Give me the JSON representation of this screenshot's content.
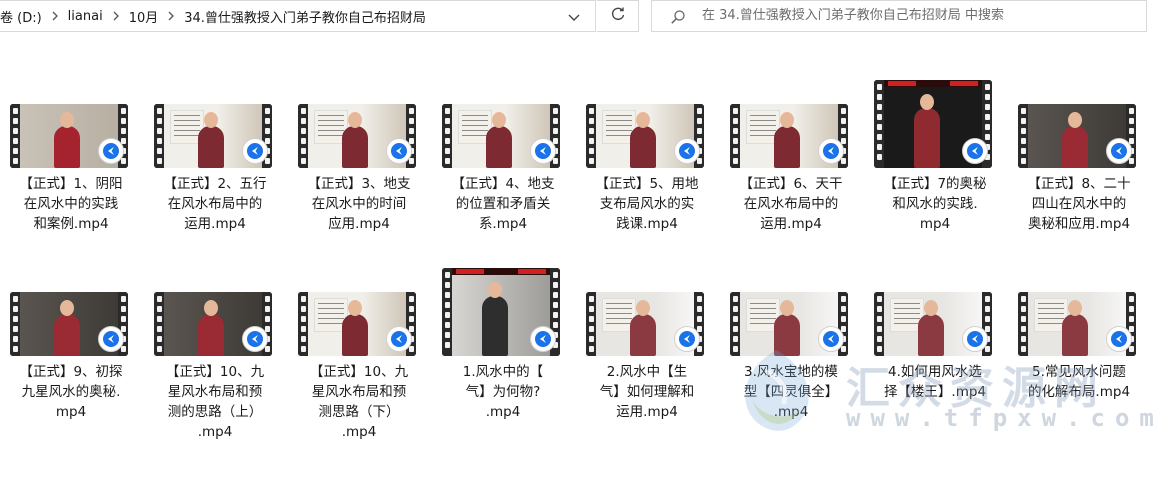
{
  "window": {
    "breadcrumbs": [
      "卷 (D:)",
      "lianai",
      "10月",
      "34.曾仕强教授入门弟子教你自己布招财局"
    ],
    "search_placeholder": "在 34.曾仕强教授入门弟子教你自己布招财局 中搜索"
  },
  "colors": {
    "accent": "#1a73e8",
    "border": "#d9d9d9",
    "text": "#1a1a1a",
    "placeholder": "#6d6d6d"
  },
  "icons": [
    "chevron-right-icon",
    "chevron-down-icon",
    "refresh-icon",
    "search-icon",
    "play-icon",
    "film-strip-icon"
  ],
  "files": [
    {
      "lines": [
        "【正式】1、阴阳",
        "在风水中的实践",
        "和案例.mp4"
      ],
      "thumb": "short",
      "scene": "red-wall"
    },
    {
      "lines": [
        "【正式】2、五行",
        "在风水布局中的",
        "运用.mp4"
      ],
      "thumb": "short",
      "scene": "board"
    },
    {
      "lines": [
        "【正式】3、地支",
        "在风水中的时间",
        "应用.mp4"
      ],
      "thumb": "short",
      "scene": "board"
    },
    {
      "lines": [
        "【正式】4、地支",
        "的位置和矛盾关",
        "系.mp4"
      ],
      "thumb": "short",
      "scene": "board"
    },
    {
      "lines": [
        "【正式】5、用地",
        "支布局风水的实",
        "践课.mp4"
      ],
      "thumb": "short",
      "scene": "board"
    },
    {
      "lines": [
        "【正式】6、天干",
        "在风水布局中的",
        "运用.mp4"
      ],
      "thumb": "short",
      "scene": "board"
    },
    {
      "lines": [
        "【正式】7的奥秘",
        "和风水的实践.",
        "mp4"
      ],
      "thumb": "tall",
      "scene": "red-banner"
    },
    {
      "lines": [
        "【正式】8、二十",
        "四山在风水中的",
        "奥秘和应用.mp4"
      ],
      "thumb": "short",
      "scene": "dark"
    },
    {
      "lines": [
        "【正式】9、初探",
        "九星风水的奥秘.",
        "mp4"
      ],
      "thumb": "short",
      "scene": "dark"
    },
    {
      "lines": [
        "【正式】10、九",
        "星风水布局和预",
        "测的思路（上）",
        ".mp4"
      ],
      "thumb": "short",
      "scene": "dark"
    },
    {
      "lines": [
        "【正式】10、九",
        "星风水布局和预",
        "测思路（下）",
        ".mp4"
      ],
      "thumb": "short",
      "scene": "board"
    },
    {
      "lines": [
        "1.风水中的【",
        "气】为何物?",
        ".mp4"
      ],
      "thumb": "tall",
      "scene": "red-banner-grey"
    },
    {
      "lines": [
        "2.风水中【生",
        "气】如何理解和",
        "运用.mp4"
      ],
      "thumb": "short",
      "scene": "whiteboard"
    },
    {
      "lines": [
        "3.风水宝地的模",
        "型【四灵俱全】",
        ".mp4"
      ],
      "thumb": "short",
      "scene": "whiteboard"
    },
    {
      "lines": [
        "4.如何用风水选",
        "择【楼王】.mp4"
      ],
      "thumb": "short",
      "scene": "whiteboard"
    },
    {
      "lines": [
        "5.常见风水问题",
        "的化解布局.mp4"
      ],
      "thumb": "short",
      "scene": "whiteboard"
    }
  ],
  "watermark": {
    "title": "汇众资源网",
    "url": "www.tfpxw.com"
  }
}
